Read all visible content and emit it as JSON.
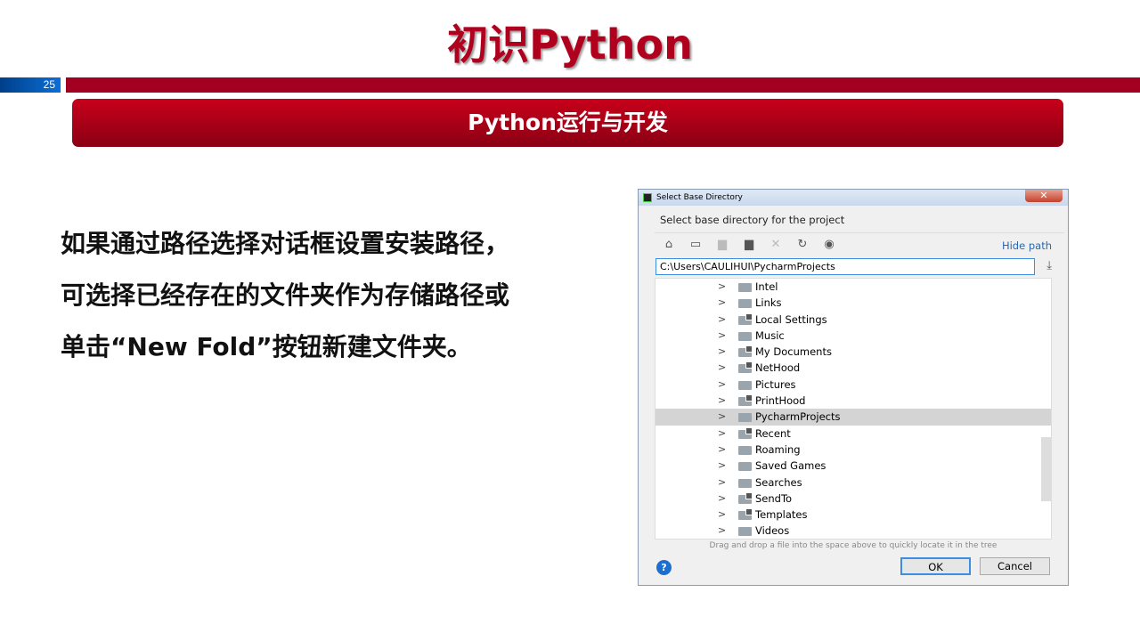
{
  "slide": {
    "title": "初识Python",
    "page_number": "25",
    "section": "Python运行与开发",
    "body_lines": [
      "如果通过路径选择对话框设置安装路径，",
      "可选择已经存在的文件夹作为存储路径或",
      "单击“New Fold”按钮新建文件夹。"
    ]
  },
  "dialog": {
    "title": "Select Base Directory",
    "close": "✕",
    "subtitle": "Select base directory for the project",
    "hide_path": "Hide path",
    "path": "C:\\Users\\CAULIHUI\\PycharmProjects",
    "items": [
      {
        "label": "Intel"
      },
      {
        "label": "Links"
      },
      {
        "label": "Local Settings"
      },
      {
        "label": "Music"
      },
      {
        "label": "My Documents"
      },
      {
        "label": "NetHood"
      },
      {
        "label": "Pictures"
      },
      {
        "label": "PrintHood"
      },
      {
        "label": "PycharmProjects"
      },
      {
        "label": "Recent"
      },
      {
        "label": "Roaming"
      },
      {
        "label": "Saved Games"
      },
      {
        "label": "Searches"
      },
      {
        "label": "SendTo"
      },
      {
        "label": "Templates"
      },
      {
        "label": "Videos"
      }
    ],
    "hint": "Drag and drop a file into the space above to quickly locate it in the tree",
    "help": "?",
    "ok": "OK",
    "cancel": "Cancel"
  }
}
